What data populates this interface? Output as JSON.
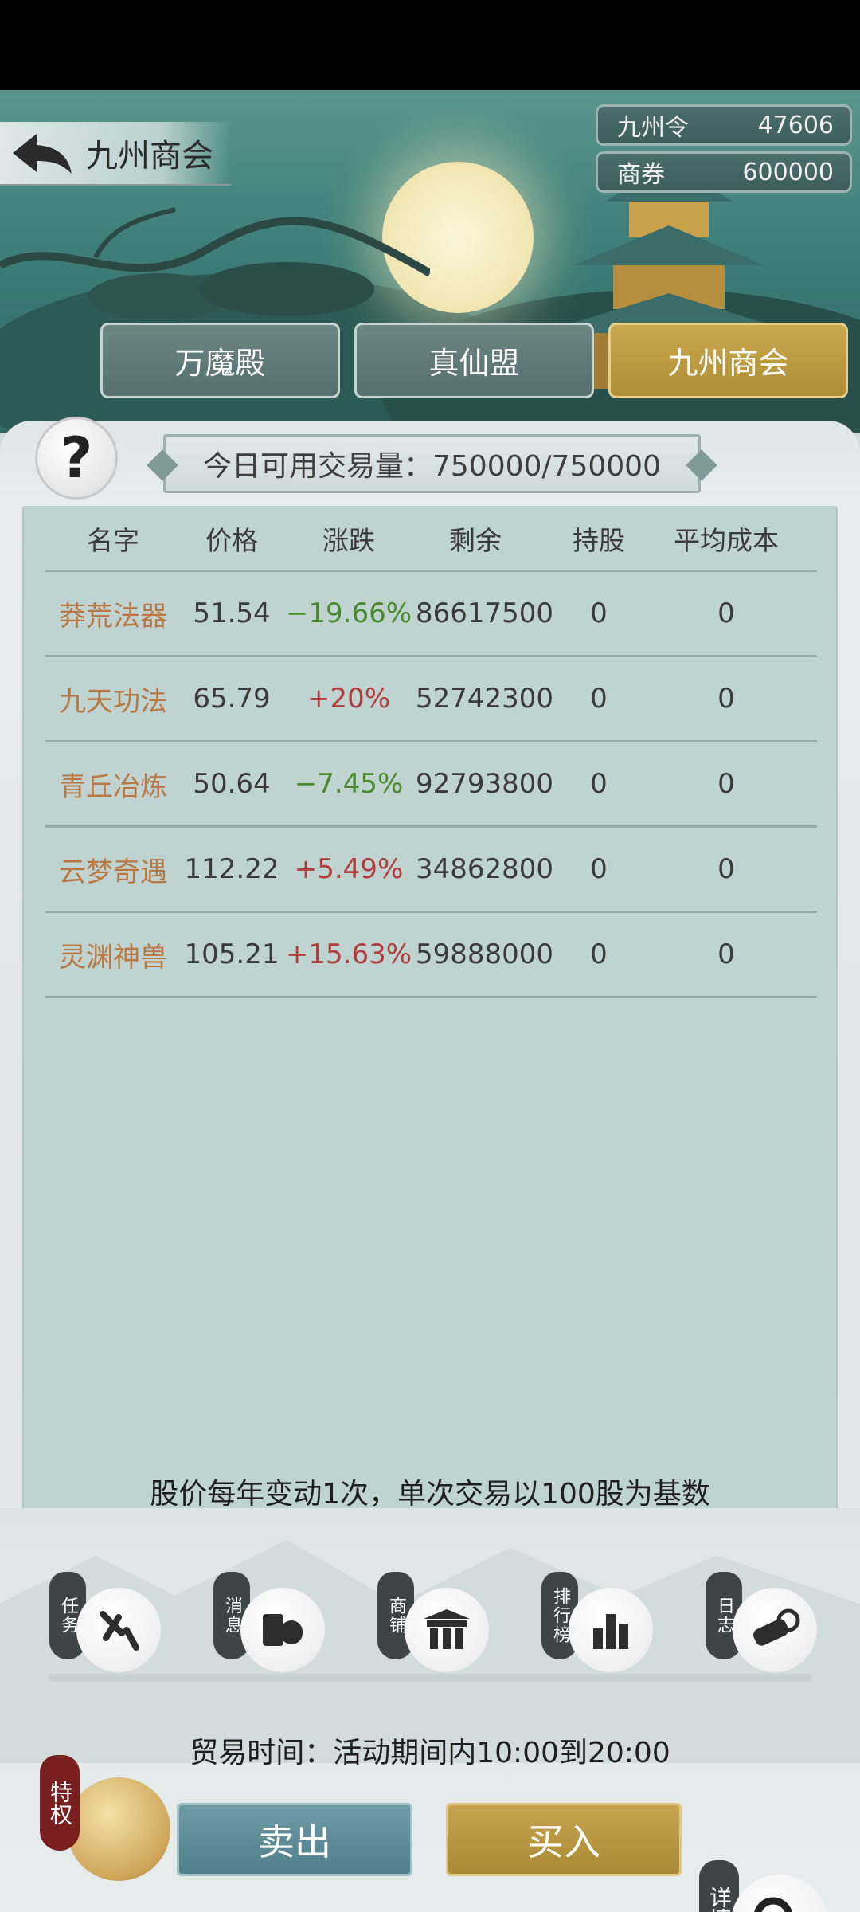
{
  "header": {
    "title": "九州商会",
    "currencies": [
      {
        "label": "九州令",
        "value": "47606"
      },
      {
        "label": "商券",
        "value": "600000"
      }
    ]
  },
  "tabs": [
    {
      "label": "万魔殿",
      "active": false
    },
    {
      "label": "真仙盟",
      "active": false
    },
    {
      "label": "九州商会",
      "active": true
    }
  ],
  "volume": "今日可用交易量：750000/750000",
  "table": {
    "headers": [
      "名字",
      "价格",
      "涨跌",
      "剩余",
      "持股",
      "平均成本"
    ],
    "rows": [
      {
        "name": "莽荒法器",
        "price": "51.54",
        "change": "−19.66%",
        "remain": "86617500",
        "hold": "0",
        "cost": "0"
      },
      {
        "name": "九天功法",
        "price": "65.79",
        "change": "+20%",
        "remain": "52742300",
        "hold": "0",
        "cost": "0"
      },
      {
        "name": "青丘冶炼",
        "price": "50.64",
        "change": "−7.45%",
        "remain": "92793800",
        "hold": "0",
        "cost": "0"
      },
      {
        "name": "云梦奇遇",
        "price": "112.22",
        "change": "+5.49%",
        "remain": "34862800",
        "hold": "0",
        "cost": "0"
      },
      {
        "name": "灵渊神兽",
        "price": "105.21",
        "change": "+15.63%",
        "remain": "59888000",
        "hold": "0",
        "cost": "0"
      }
    ]
  },
  "note": "股价每年变动1次，单次交易以100股为基数",
  "nav": [
    {
      "label": "任务",
      "icon": "brush-icon"
    },
    {
      "label": "消息",
      "icon": "scroll-icon"
    },
    {
      "label": "商铺",
      "icon": "shop-gate-icon"
    },
    {
      "label": "排行榜",
      "icon": "ranking-icon"
    },
    {
      "label": "日志",
      "icon": "log-scroll-icon"
    }
  ],
  "trade_time": "贸易时间：活动期间内10:00到20:00",
  "privilege_label": "特权",
  "sell_label": "卖出",
  "buy_label": "买入",
  "details_label": "详情",
  "colors": {
    "gain": "#b13c3c",
    "loss": "#4a8a2c",
    "name": "#b97843",
    "active_tab": "#c9a84f"
  }
}
